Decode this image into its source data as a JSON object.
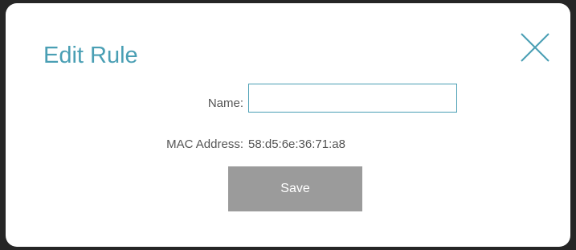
{
  "dialog": {
    "title": "Edit Rule",
    "close_icon": "close-icon"
  },
  "form": {
    "name_label": "Name:",
    "name_value": "",
    "name_placeholder": "",
    "mac_label": "MAC Address:",
    "mac_value": "58:d5:6e:36:71:a8"
  },
  "actions": {
    "save_label": "Save"
  },
  "colors": {
    "accent": "#4a9fb4",
    "button_bg": "#9b9b9b",
    "backdrop": "#262626"
  }
}
